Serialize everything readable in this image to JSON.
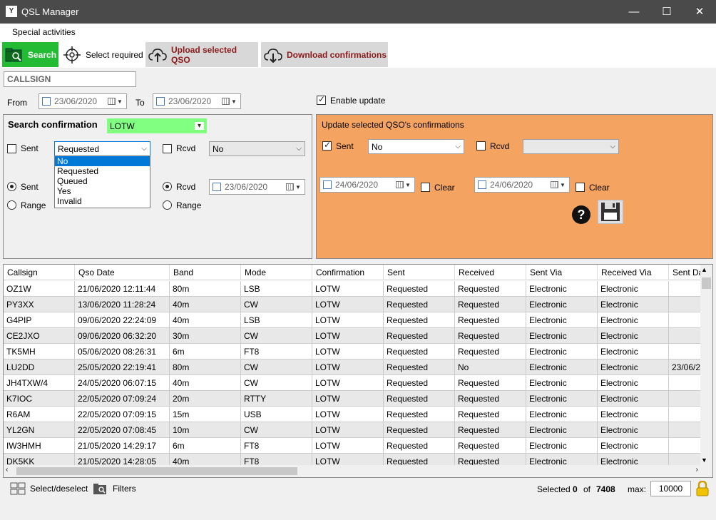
{
  "window": {
    "title": "QSL Manager",
    "minimize": "—",
    "maximize": "☐",
    "close": "✕"
  },
  "menu": {
    "items": [
      "Special activities"
    ]
  },
  "toolbar": {
    "search_label": "Search",
    "select_label": "Select required",
    "upload_label": "Upload selected QSO",
    "download_label": "Download confirmations"
  },
  "filters": {
    "callsign_placeholder": "CALLSIGN",
    "from_label": "From",
    "from_date": "23/06/2020",
    "to_label": "To",
    "to_date": "23/06/2020",
    "enable_update_label": "Enable update"
  },
  "search_panel": {
    "title": "Search confirmation",
    "confirmation_type": "LOTW",
    "sent_label": "Sent",
    "sent_value": "Requested",
    "rcvd_label": "Rcvd",
    "rcvd_value": "No",
    "sent_radio_label": "Sent",
    "range_label_1": "Range",
    "rcvd_radio_label": "Rcvd",
    "range_label_2": "Range",
    "rcvd_date": "23/06/2020",
    "dropdown_options": [
      "No",
      "Requested",
      "Queued",
      "Yes",
      "Invalid"
    ]
  },
  "update_panel": {
    "title": "Update selected QSO's confirmations",
    "sent_label": "Sent",
    "sent_value": "No",
    "rcvd_label": "Rcvd",
    "rcvd_value": "",
    "date1": "24/06/2020",
    "clear1": "Clear",
    "date2": "24/06/2020",
    "clear2": "Clear",
    "help_icon": "?"
  },
  "grid": {
    "columns": [
      "Callsign",
      "Qso Date",
      "Band",
      "Mode",
      "Confirmation",
      "Sent",
      "Received",
      "Sent Via",
      "Received Via",
      "Sent Date"
    ],
    "rows": [
      [
        "OZ1W",
        "21/06/2020 12:11:44",
        "80m",
        "LSB",
        "LOTW",
        "Requested",
        "Requested",
        "Electronic",
        "Electronic",
        ""
      ],
      [
        "PY3XX",
        "13/06/2020 11:28:24",
        "40m",
        "CW",
        "LOTW",
        "Requested",
        "Requested",
        "Electronic",
        "Electronic",
        ""
      ],
      [
        "G4PIP",
        "09/06/2020 22:24:09",
        "40m",
        "LSB",
        "LOTW",
        "Requested",
        "Requested",
        "Electronic",
        "Electronic",
        ""
      ],
      [
        "CE2JXO",
        "09/06/2020 06:32:20",
        "30m",
        "CW",
        "LOTW",
        "Requested",
        "Requested",
        "Electronic",
        "Electronic",
        ""
      ],
      [
        "TK5MH",
        "05/06/2020 08:26:31",
        "6m",
        "FT8",
        "LOTW",
        "Requested",
        "Requested",
        "Electronic",
        "Electronic",
        ""
      ],
      [
        "LU2DD",
        "25/05/2020 22:19:41",
        "80m",
        "CW",
        "LOTW",
        "Requested",
        "No",
        "Electronic",
        "Electronic",
        "23/06/2"
      ],
      [
        "JH4TXW/4",
        "24/05/2020 06:07:15",
        "40m",
        "CW",
        "LOTW",
        "Requested",
        "Requested",
        "Electronic",
        "Electronic",
        ""
      ],
      [
        "K7IOC",
        "22/05/2020 07:09:24",
        "20m",
        "RTTY",
        "LOTW",
        "Requested",
        "Requested",
        "Electronic",
        "Electronic",
        ""
      ],
      [
        "R6AM",
        "22/05/2020 07:09:15",
        "15m",
        "USB",
        "LOTW",
        "Requested",
        "Requested",
        "Electronic",
        "Electronic",
        ""
      ],
      [
        "YL2GN",
        "22/05/2020 07:08:45",
        "10m",
        "CW",
        "LOTW",
        "Requested",
        "Requested",
        "Electronic",
        "Electronic",
        ""
      ],
      [
        "IW3HMH",
        "21/05/2020 14:29:17",
        "6m",
        "FT8",
        "LOTW",
        "Requested",
        "Requested",
        "Electronic",
        "Electronic",
        ""
      ],
      [
        "DK5KK",
        "21/05/2020 14:28:05",
        "40m",
        "FT8",
        "LOTW",
        "Requested",
        "Requested",
        "Electronic",
        "Electronic",
        ""
      ]
    ]
  },
  "status": {
    "select_deselect_label": "Select/deselect",
    "filters_label": "Filters",
    "selected_label": "Selected",
    "selected_count": "0",
    "of_label": "of",
    "total_count": "7408",
    "max_label": "max:",
    "max_value": "10000"
  },
  "colors": {
    "search_green": "#22bb33",
    "update_orange": "#f4a460",
    "lotw_green": "#80ff80",
    "selection_blue": "#0078d7",
    "upload_red": "#8b1a1a"
  }
}
